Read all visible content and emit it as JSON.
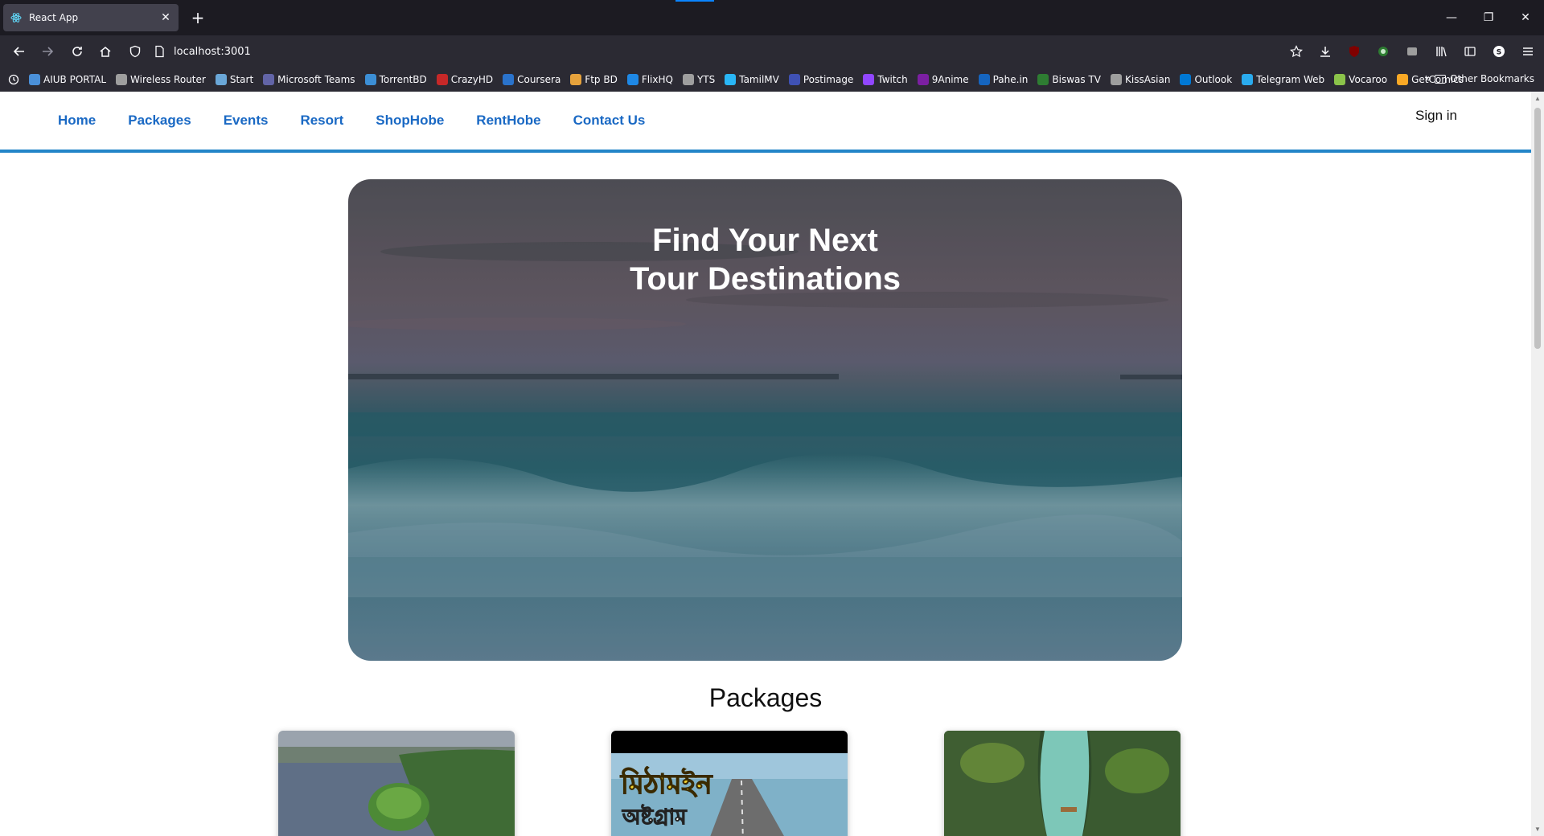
{
  "browser": {
    "tab_title": "React App",
    "tab_close": "✕",
    "new_tab": "+",
    "url": "localhost:3001",
    "window_controls": {
      "minimize": "—",
      "restore": "❐",
      "close": "✕"
    },
    "bookmarks": [
      {
        "label": "AIUB PORTAL",
        "color": "#4a90d9"
      },
      {
        "label": "Wireless Router",
        "color": "#9e9e9e"
      },
      {
        "label": "Start",
        "color": "#6aa7d8"
      },
      {
        "label": "Microsoft Teams",
        "color": "#6264a7"
      },
      {
        "label": "TorrentBD",
        "color": "#3c8fd6"
      },
      {
        "label": "CrazyHD",
        "color": "#c62828"
      },
      {
        "label": "Coursera",
        "color": "#2a73cc"
      },
      {
        "label": "Ftp BD",
        "color": "#e6a23c"
      },
      {
        "label": "FlixHQ",
        "color": "#1e88e5"
      },
      {
        "label": "YTS",
        "color": "#9e9e9e"
      },
      {
        "label": "TamilMV",
        "color": "#29b6f6"
      },
      {
        "label": "Postimage",
        "color": "#3f51b5"
      },
      {
        "label": "Twitch",
        "color": "#9146ff"
      },
      {
        "label": "9Anime",
        "color": "#7b1fa2"
      },
      {
        "label": "Pahe.in",
        "color": "#1565c0"
      },
      {
        "label": "Biswas TV",
        "color": "#2e7d32"
      },
      {
        "label": "KissAsian",
        "color": "#9e9e9e"
      },
      {
        "label": "Outlook",
        "color": "#0078d4"
      },
      {
        "label": "Telegram Web",
        "color": "#2aabee"
      },
      {
        "label": "Vocaroo",
        "color": "#8bc34a"
      },
      {
        "label": "GetComics",
        "color": "#f9a825"
      }
    ],
    "other_bookmarks": "Other Bookmarks",
    "more_bookmarks": "»"
  },
  "site": {
    "nav_links": [
      "Home",
      "Packages",
      "Events",
      "Resort",
      "ShopHobe",
      "RentHobe",
      "Contact Us"
    ],
    "sign_in": "Sign in",
    "hero_title_line1": "Find Your Next",
    "hero_title_line2": "Tour Destinations",
    "packages_title": "Packages",
    "card2_caption_line1": "মিঠামইন",
    "card2_caption_line2": "অষ্টগ্রাম"
  },
  "colors": {
    "nav_link": "#1a69c4",
    "nav_border": "#2385c8",
    "browser_bg": "#1c1b22"
  }
}
